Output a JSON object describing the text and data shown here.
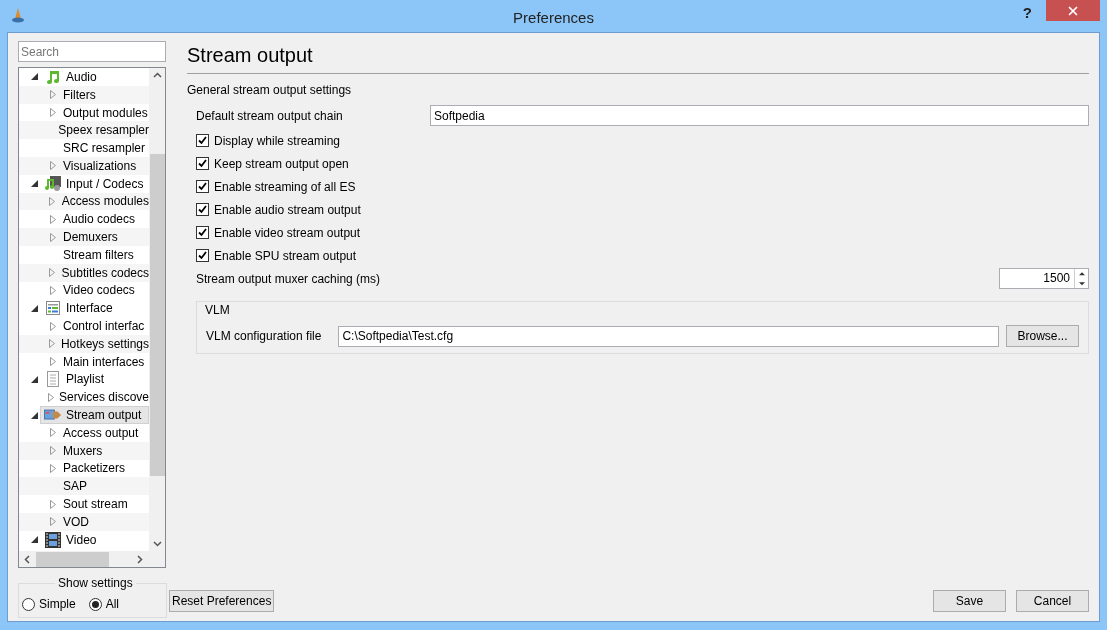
{
  "window": {
    "title": "Preferences",
    "help": "?"
  },
  "sidebar": {
    "search": {
      "placeholder": "Search"
    },
    "tree": [
      {
        "label": "Audio",
        "expanded": true,
        "children": [
          {
            "label": "Filters",
            "expandable": true
          },
          {
            "label": "Output modules",
            "expandable": true
          },
          {
            "label": "Speex resampler",
            "expandable": false
          },
          {
            "label": "SRC resampler",
            "expandable": false
          },
          {
            "label": "Visualizations",
            "expandable": true
          }
        ],
        "selected": false
      },
      {
        "label": "Input / Codecs",
        "expanded": true,
        "children": [
          {
            "label": "Access modules",
            "expandable": true
          },
          {
            "label": "Audio codecs",
            "expandable": true
          },
          {
            "label": "Demuxers",
            "expandable": true
          },
          {
            "label": "Stream filters",
            "expandable": false
          },
          {
            "label": "Subtitles codecs",
            "expandable": true
          },
          {
            "label": "Video codecs",
            "expandable": true
          }
        ],
        "selected": false
      },
      {
        "label": "Interface",
        "expanded": true,
        "children": [
          {
            "label": "Control interfac",
            "expandable": true
          },
          {
            "label": "Hotkeys settings",
            "expandable": true
          },
          {
            "label": "Main interfaces",
            "expandable": true
          }
        ],
        "selected": false
      },
      {
        "label": "Playlist",
        "expanded": true,
        "children": [
          {
            "label": "Services discove",
            "expandable": true
          }
        ],
        "selected": false
      },
      {
        "label": "Stream output",
        "expanded": true,
        "children": [
          {
            "label": "Access output",
            "expandable": true
          },
          {
            "label": "Muxers",
            "expandable": true
          },
          {
            "label": "Packetizers",
            "expandable": true
          },
          {
            "label": "SAP",
            "expandable": false
          },
          {
            "label": "Sout stream",
            "expandable": true
          },
          {
            "label": "VOD",
            "expandable": true
          }
        ],
        "selected": true
      },
      {
        "label": "Video",
        "expanded": true,
        "selected": false
      }
    ],
    "show_settings": {
      "title": "Show settings",
      "options": [
        {
          "label": "Simple",
          "selected": false
        },
        {
          "label": "All",
          "selected": true
        }
      ]
    }
  },
  "page": {
    "title": "Stream output",
    "subtitle": "General stream output settings",
    "chain": {
      "label": "Default stream output chain",
      "value": "Softpedia"
    },
    "options": [
      {
        "label": "Display while streaming",
        "checked": true
      },
      {
        "label": "Keep stream output open",
        "checked": true
      },
      {
        "label": "Enable streaming of all ES",
        "checked": true
      },
      {
        "label": "Enable audio stream output",
        "checked": true
      },
      {
        "label": "Enable video stream output",
        "checked": true
      },
      {
        "label": "Enable SPU stream output",
        "checked": true
      }
    ],
    "caching": {
      "label": "Stream output muxer caching (ms)",
      "value": "1500"
    },
    "vlm": {
      "title": "VLM",
      "label": "VLM configuration file",
      "value": "C:\\Softpedia\\Test.cfg",
      "button": "Browse..."
    }
  },
  "buttons": {
    "reset": "Reset Preferences",
    "save": "Save",
    "cancel": "Cancel"
  }
}
